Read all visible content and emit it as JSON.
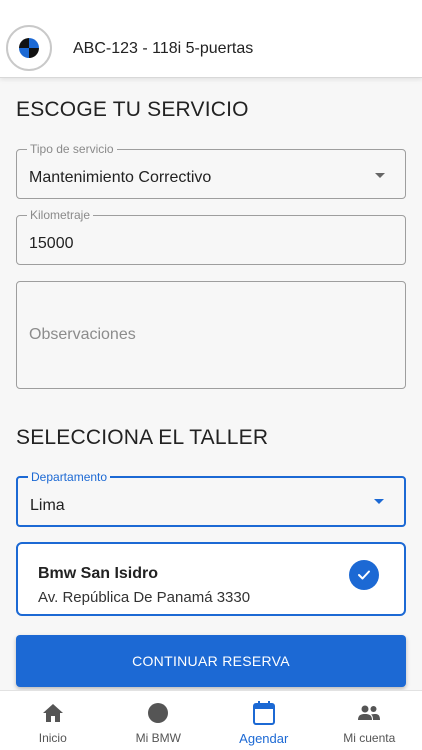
{
  "header": {
    "title": "ABC-123 - 118i 5-puertas",
    "logo_icon": "bmw-roundel-icon"
  },
  "service_section": {
    "title": "ESCOGE TU SERVICIO",
    "service_type": {
      "label": "Tipo de servicio",
      "value": "Mantenimiento Correctivo"
    },
    "mileage": {
      "label": "Kilometraje",
      "value": "15000"
    },
    "notes": {
      "placeholder": "Observaciones"
    }
  },
  "workshop_section": {
    "title": "SELECCIONA EL TALLER",
    "department": {
      "label": "Departamento",
      "value": "Lima"
    },
    "workshop": {
      "name": "Bmw San Isidro",
      "address": "Av. República De Panamá 3330",
      "selected": true
    }
  },
  "cta": {
    "label": "CONTINUAR RESERVA"
  },
  "tabbar": {
    "tabs": [
      {
        "label": "Inicio",
        "icon": "home-icon",
        "active": false
      },
      {
        "label": "Mi BMW",
        "icon": "circle-icon",
        "active": false
      },
      {
        "label": "Agendar",
        "icon": "calendar-icon",
        "active": true
      },
      {
        "label": "Mi cuenta",
        "icon": "people-icon",
        "active": false
      }
    ]
  },
  "colors": {
    "accent": "#1c69d4",
    "background": "#f7f7f7",
    "text": "#222222"
  }
}
